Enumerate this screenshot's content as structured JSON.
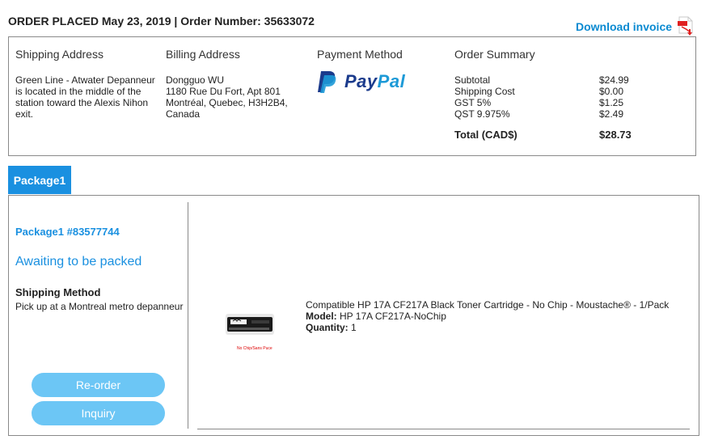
{
  "order": {
    "header": "ORDER PLACED May 23, 2019 | Order Number: 35633072",
    "download_label": "Download invoice"
  },
  "shipping": {
    "title": "Shipping Address",
    "lines": [
      "Green Line - Atwater Depanneur is located in the middle of the station toward the Alexis Nihon exit."
    ]
  },
  "billing": {
    "title": "Billing Address",
    "lines": [
      "Dongguo WU",
      "1180 Rue Du Fort, Apt 801",
      "Montréal, Quebec, H3H2B4,",
      "Canada"
    ]
  },
  "payment": {
    "title": "Payment Method",
    "brand_part1": "Pay",
    "brand_part2": "Pal"
  },
  "summary": {
    "title": "Order Summary",
    "rows": [
      {
        "label": "Subtotal",
        "value": "$24.99"
      },
      {
        "label": "Shipping Cost",
        "value": "$0.00"
      },
      {
        "label": "GST 5%",
        "value": "$1.25"
      },
      {
        "label": "QST 9.975%",
        "value": "$2.49"
      }
    ],
    "total_label": "Total (CAD$)",
    "total_value": "$28.73"
  },
  "package": {
    "tab_label": "Package1",
    "id_label": "Package1 #83577744",
    "status": "Awaiting to be packed",
    "ship_method_label": "Shipping Method",
    "ship_method_value": "Pick up at a Montreal metro depanneur",
    "reorder_label": "Re-order",
    "inquiry_label": "Inquiry"
  },
  "product": {
    "name": "Compatible HP 17A CF217A Black Toner Cartridge - No Chip - Moustache® - 1/Pack",
    "model_label": "Model:",
    "model_value": "HP 17A CF217A-NoChip",
    "qty_label": "Quantity:",
    "qty_value": "1",
    "image_caption": "No Chip/Sans Puce"
  },
  "colors": {
    "accent": "#1a90e0",
    "button": "#6cc6f5",
    "border": "#8a8a8a",
    "pdf_red": "#e02020"
  }
}
